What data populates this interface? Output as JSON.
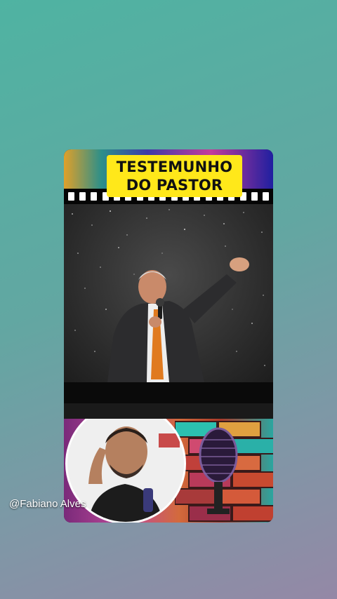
{
  "video": {
    "title_line1": "TESTEMUNHO",
    "title_line2": "DO PASTOR",
    "creator_handle": "@Fabiano Alves"
  },
  "colors": {
    "title_bg": "#ffe81a",
    "background_top": "#4fb3a2",
    "background_bottom": "#9488a6"
  },
  "icons": [
    "microphone-icon"
  ]
}
